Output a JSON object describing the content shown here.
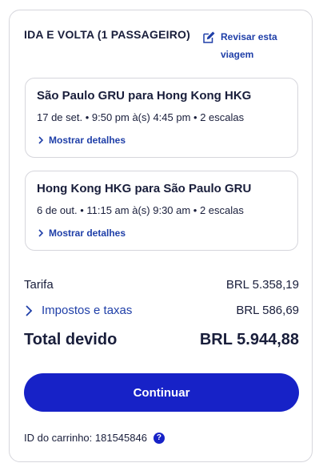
{
  "trip": {
    "title": "IDA E VOLTA (1 PASSAGEIRO)",
    "edit_label": "Revisar esta viagem",
    "edit_icon": "edit-pencil-icon"
  },
  "legs": [
    {
      "route": "São Paulo GRU para Hong Kong HKG",
      "times": "17 de set. • 9:50 pm à(s) 4:45 pm • 2 escalas",
      "details_label": "Mostrar detalhes"
    },
    {
      "route": "Hong Kong HKG para São Paulo GRU",
      "times": "6 de out. • 11:15 am à(s) 9:30 am • 2 escalas",
      "details_label": "Mostrar detalhes"
    }
  ],
  "pricing": {
    "fare_label": "Tarifa",
    "fare_value": "BRL 5.358,19",
    "taxes_label": "Impostos e taxas",
    "taxes_value": "BRL 586,69",
    "total_label": "Total devido",
    "total_value": "BRL 5.944,88"
  },
  "continue_label": "Continuar",
  "cart": {
    "label": "ID do carrinho: 181545846",
    "help_glyph": "?"
  },
  "colors": {
    "accent": "#1722c7",
    "link": "#1f3fa8",
    "text": "#191e3b",
    "border": "#d6d6dc"
  }
}
